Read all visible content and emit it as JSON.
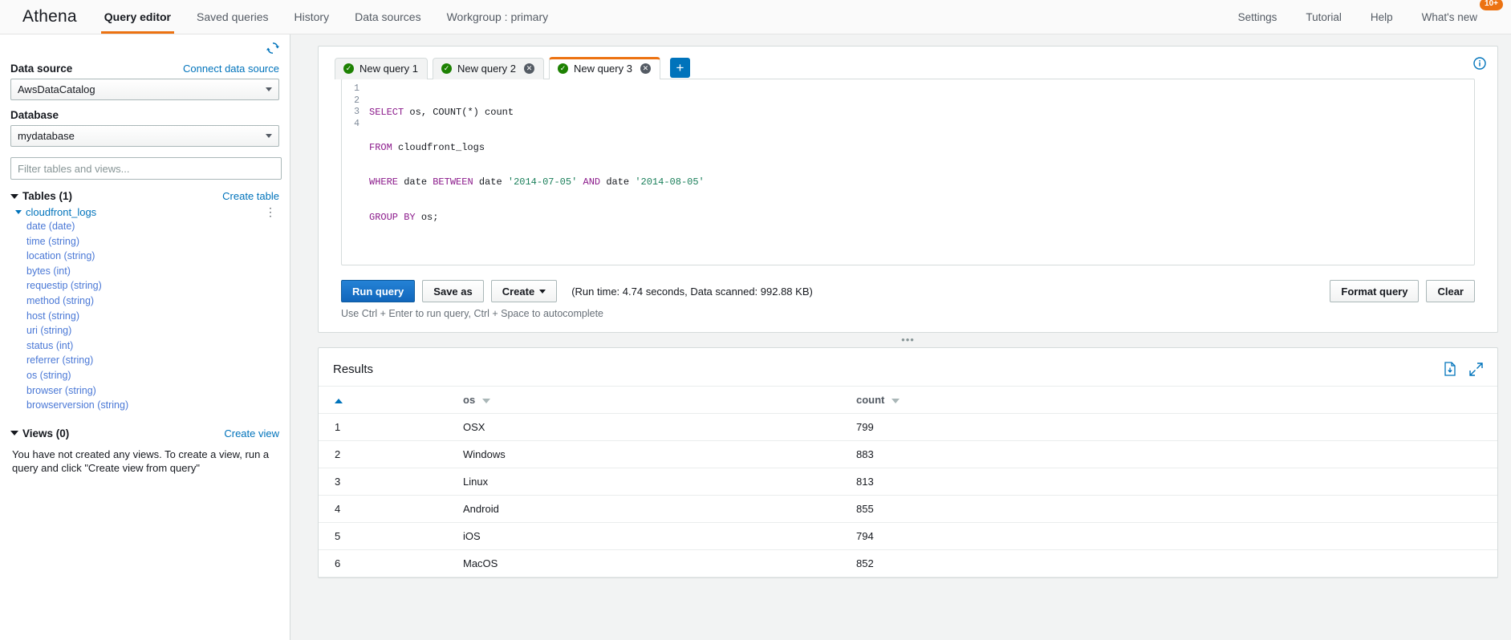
{
  "topnav": {
    "brand": "Athena",
    "items": [
      {
        "label": "Query editor",
        "active": true
      },
      {
        "label": "Saved queries",
        "active": false
      },
      {
        "label": "History",
        "active": false
      },
      {
        "label": "Data sources",
        "active": false
      },
      {
        "label": "Workgroup : primary",
        "active": false
      }
    ],
    "right_items": [
      {
        "label": "Settings"
      },
      {
        "label": "Tutorial"
      },
      {
        "label": "Help"
      },
      {
        "label": "What's new"
      }
    ],
    "whats_new_badge": "10+",
    "accent_color": "#ec7211"
  },
  "sidebar": {
    "refresh_icon": "refresh-icon",
    "data_source_label": "Data source",
    "connect_data_source_link": "Connect data source",
    "data_source_value": "AwsDataCatalog",
    "database_label": "Database",
    "database_value": "mydatabase",
    "filter_placeholder": "Filter tables and views...",
    "filter_value": "",
    "tables_section": {
      "title": "Tables (1)",
      "create_link": "Create table",
      "table_name": "cloudfront_logs",
      "columns": [
        "date (date)",
        "time (string)",
        "location (string)",
        "bytes (int)",
        "requestip (string)",
        "method (string)",
        "host (string)",
        "uri (string)",
        "status (int)",
        "referrer (string)",
        "os (string)",
        "browser (string)",
        "browserversion (string)"
      ]
    },
    "views_section": {
      "title": "Views (0)",
      "create_link": "Create view",
      "empty_text": "You have not created any views. To create a view, run a query and click \"Create view from query\""
    },
    "collapse_icon": "chevron-left-icon"
  },
  "editor": {
    "info_icon": "info-icon",
    "tabs": [
      {
        "label": "New query 1",
        "active": false,
        "closable": false,
        "status": "ok"
      },
      {
        "label": "New query 2",
        "active": false,
        "closable": true,
        "status": "ok"
      },
      {
        "label": "New query 3",
        "active": true,
        "closable": true,
        "status": "ok"
      }
    ],
    "add_tab_label": "+",
    "line_numbers": [
      "1",
      "2",
      "3",
      "4"
    ],
    "sql_lines": [
      "SELECT os, COUNT(*) count",
      "FROM cloudfront_logs",
      "WHERE date BETWEEN date '2014-07-05' AND date '2014-08-05'",
      "GROUP BY os;"
    ],
    "buttons": {
      "run": "Run query",
      "save_as": "Save as",
      "create": "Create",
      "format": "Format query",
      "clear": "Clear"
    },
    "run_info": "(Run time: 4.74 seconds, Data scanned: 992.88 KB)",
    "hint": "Use Ctrl + Enter to run query, Ctrl + Space to autocomplete",
    "splitter_glyph": "•••"
  },
  "results": {
    "title": "Results",
    "download_icon": "download-file-icon",
    "expand_icon": "expand-icon",
    "columns": [
      "",
      "os",
      "count"
    ],
    "rows": [
      {
        "idx": "1",
        "os": "OSX",
        "count": "799"
      },
      {
        "idx": "2",
        "os": "Windows",
        "count": "883"
      },
      {
        "idx": "3",
        "os": "Linux",
        "count": "813"
      },
      {
        "idx": "4",
        "os": "Android",
        "count": "855"
      },
      {
        "idx": "5",
        "os": "iOS",
        "count": "794"
      },
      {
        "idx": "6",
        "os": "MacOS",
        "count": "852"
      }
    ]
  }
}
